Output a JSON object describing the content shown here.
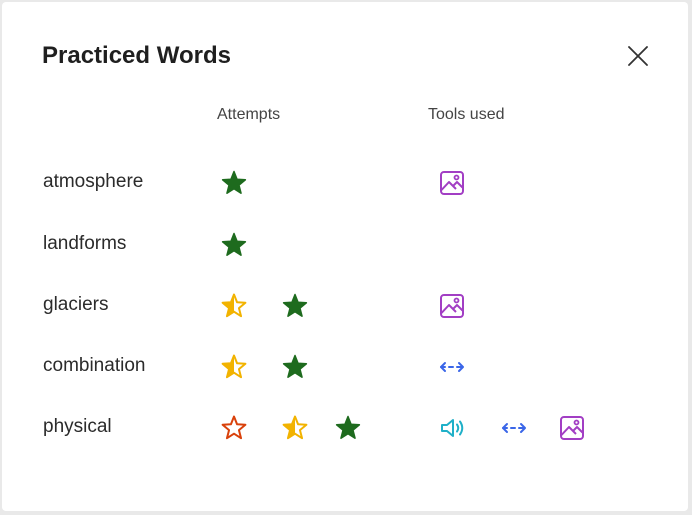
{
  "dialog": {
    "title": "Practiced Words",
    "close_label": "Close"
  },
  "columns": {
    "attempts": "Attempts",
    "tools_used": "Tools used"
  },
  "colors": {
    "star_correct": "#1e6b1e",
    "star_partial": "#f2b300",
    "star_wrong": "#d9410b",
    "tool_image": "#a23ec4",
    "tool_syllables": "#3a66e8",
    "tool_audio": "#1fb0c8"
  },
  "words": [
    {
      "word": "atmosphere",
      "attempts": [
        "correct"
      ],
      "tools": [
        "image-icon"
      ]
    },
    {
      "word": "landforms",
      "attempts": [
        "correct"
      ],
      "tools": []
    },
    {
      "word": "glaciers",
      "attempts": [
        "partial",
        "correct"
      ],
      "tools": [
        "image-icon"
      ]
    },
    {
      "word": "combination",
      "attempts": [
        "partial",
        "correct"
      ],
      "tools": [
        "syllables-icon"
      ]
    },
    {
      "word": "physical",
      "attempts": [
        "wrong",
        "partial",
        "correct"
      ],
      "tools": [
        "speaker-icon",
        "syllables-icon",
        "image-icon"
      ]
    }
  ]
}
